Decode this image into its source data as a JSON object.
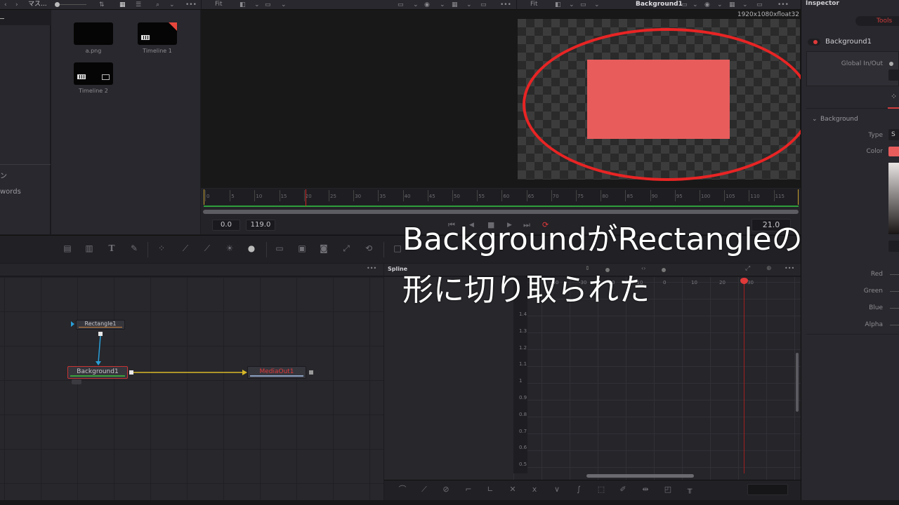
{
  "top_toolbar": {
    "nav_back": "‹",
    "nav_forward": "›",
    "bin_label": "マス...",
    "viewer_left_fit": "Fit",
    "viewer_right_fit": "Fit",
    "viewer_right_node": "Background1",
    "inspector_title": "Inspector"
  },
  "left_panel": {
    "items": [
      {
        "label": "ン"
      },
      {
        "label": "words"
      }
    ]
  },
  "media_pool": {
    "clips": [
      {
        "name": "a.png",
        "type": "image"
      },
      {
        "name": "Timeline 1",
        "type": "timeline",
        "flagged": true
      },
      {
        "name": "Timeline 2",
        "type": "timeline"
      }
    ]
  },
  "viewer": {
    "resolution": "1920x1080xfloat32",
    "shape_color": "#e85c5c",
    "annotation_color": "#e82424"
  },
  "timeline_ruler": {
    "ticks": [
      "0",
      "5",
      "10",
      "15",
      "20",
      "25",
      "30",
      "35",
      "40",
      "45",
      "50",
      "55",
      "60",
      "65",
      "70",
      "75",
      "80",
      "85",
      "90",
      "95",
      "100",
      "105",
      "110",
      "115"
    ],
    "current_frame_marker": 21,
    "start": "0.0",
    "end": "119.0",
    "current": "21.0"
  },
  "transport": {
    "to_start": "⏮",
    "step_back": "◀",
    "stop": "■",
    "play": "▶",
    "to_end": "⏭",
    "loop": "⟳"
  },
  "tools_bar": {
    "icons": [
      "background-icon",
      "paint-icon",
      "text-icon",
      "brush-icon",
      "particles-icon",
      "curves-icon",
      "color-curves-icon",
      "brightness-icon",
      "blur-icon",
      "merge-icon",
      "channel-booleans-icon",
      "matte-control-icon",
      "resize-icon",
      "transform-icon",
      "rectangle-mask-icon"
    ]
  },
  "node_editor": {
    "more": "•••",
    "nodes": [
      {
        "name": "Rectangle1",
        "bar_color": "#c8823c"
      },
      {
        "name": "Background1",
        "bar_color": "#3ca03c",
        "selected": true
      },
      {
        "name": "MediaOut1",
        "bar_color": "#8aa0c0",
        "text_color": "#e03a3a"
      }
    ]
  },
  "spline_editor": {
    "title": "Spline",
    "more": "•••",
    "y_ticks": [
      "1.4",
      "1.3",
      "1.2",
      "1.1",
      "1",
      "0.9",
      "0.8",
      "0.7",
      "0.6",
      "0.5"
    ],
    "x_ticks": [
      "-40",
      "-30",
      "-20",
      "-10",
      "0",
      "10",
      "20",
      "30"
    ]
  },
  "inspector": {
    "tab": "Tools",
    "node_name": "Background1",
    "global_in_out": "Global In/Out",
    "section": "Background",
    "fields": [
      {
        "label": "Type",
        "value": "S"
      },
      {
        "label": "Color"
      },
      {
        "label": "Red"
      },
      {
        "label": "Green"
      },
      {
        "label": "Blue"
      },
      {
        "label": "Alpha"
      }
    ],
    "color_swatch": "#e85c5c"
  },
  "annotation": {
    "line1": "BackgroundがRectangleの",
    "line2": "形に切り取られた"
  }
}
